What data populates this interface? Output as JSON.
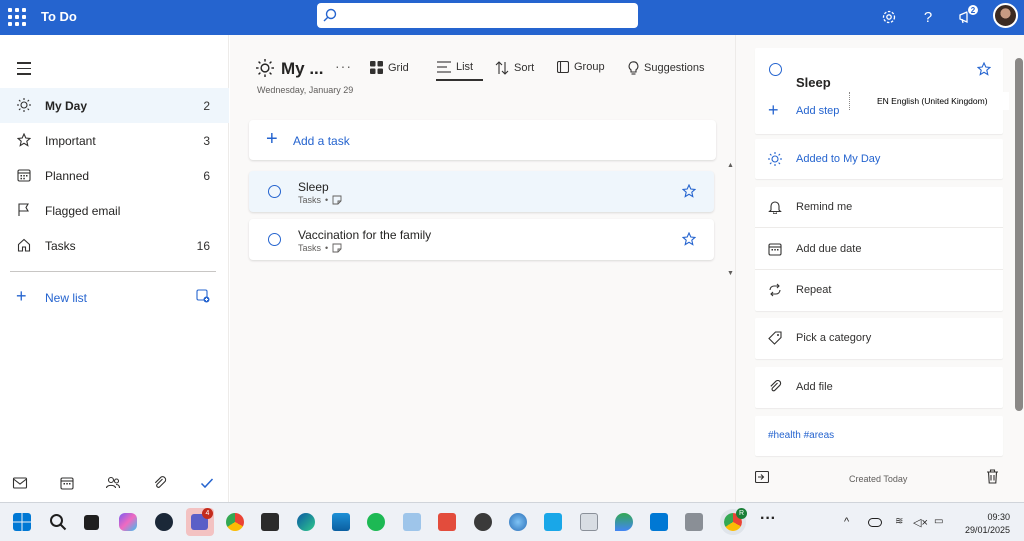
{
  "app": {
    "title": "To Do",
    "notifications_count": "2"
  },
  "search": {
    "placeholder": "",
    "value": ""
  },
  "sidebar": {
    "items": [
      {
        "label": "My Day",
        "count": "2",
        "icon": "sun-icon",
        "active": true
      },
      {
        "label": "Important",
        "count": "3",
        "icon": "star-icon"
      },
      {
        "label": "Planned",
        "count": "6",
        "icon": "calendar-icon"
      },
      {
        "label": "Flagged email",
        "count": "",
        "icon": "flag-icon"
      },
      {
        "label": "Tasks",
        "count": "16",
        "icon": "home-icon"
      }
    ],
    "new_list_label": "New list",
    "bottom_icons": [
      "mail-icon",
      "calendar-icon",
      "people-icon",
      "attachment-icon",
      "todo-check-icon"
    ]
  },
  "main": {
    "title": "My ...",
    "date": "Wednesday, January 29",
    "toolbar": {
      "grid_label": "Grid",
      "list_label": "List",
      "sort_label": "Sort",
      "group_label": "Group",
      "suggestions_label": "Suggestions"
    },
    "add_task_label": "Add a task",
    "tasks": [
      {
        "title": "Sleep",
        "list": "Tasks",
        "separator": "•"
      },
      {
        "title": "Vaccination for the family",
        "list": "Tasks",
        "separator": "•"
      }
    ]
  },
  "detail": {
    "task_title": "Sleep",
    "add_step_label": "Add step",
    "my_day_label": "Added to My Day",
    "remind_label": "Remind me",
    "due_label": "Add due date",
    "repeat_label": "Repeat",
    "category_label": "Pick a category",
    "file_label": "Add file",
    "note": "#health #areas",
    "created_label": "Created Today"
  },
  "tooltip": "EN English (United Kingdom)",
  "taskbar": {
    "teams_badge": "4",
    "todo_badge": "R",
    "time": "09:30",
    "date": "29/01/2025"
  },
  "colors": {
    "accent": "#2564cf",
    "selected_bg": "#eff6fc",
    "main_bg": "#faf9f8"
  }
}
